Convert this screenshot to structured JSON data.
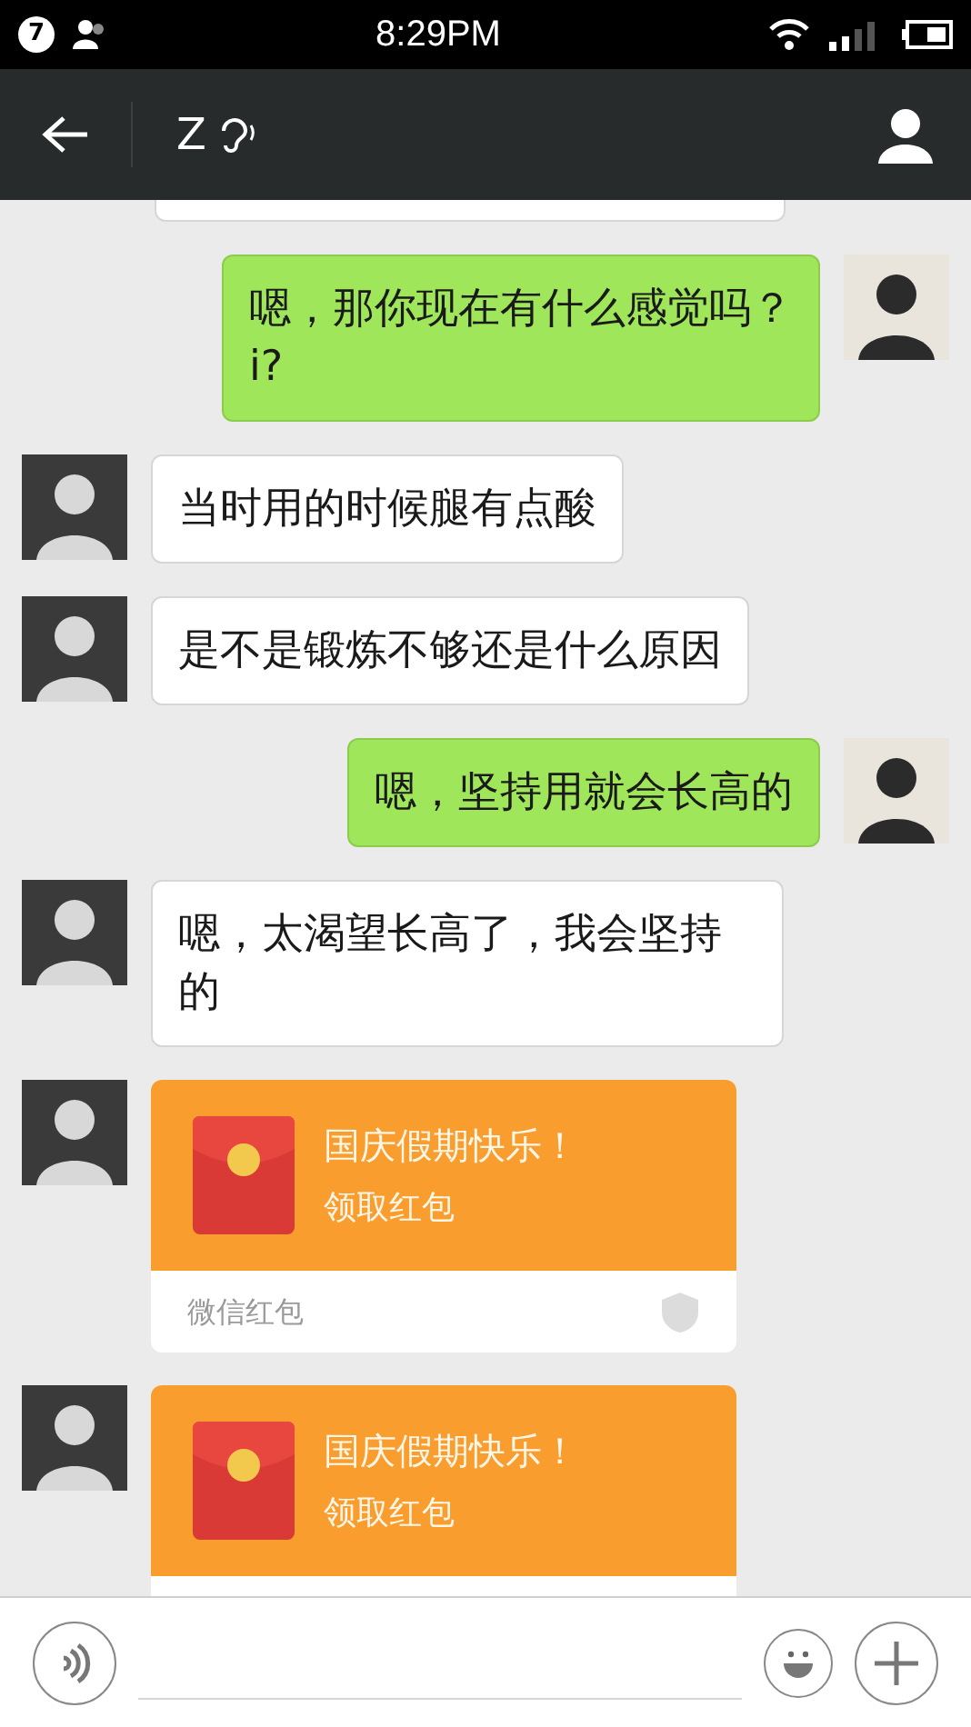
{
  "status_bar": {
    "notification_count": "7",
    "time": "8:29PM"
  },
  "header": {
    "title": "Z"
  },
  "messages": [
    {
      "kind": "text",
      "outgoing": true,
      "text": "嗯，那你现在有什么感觉吗？\ni?"
    },
    {
      "kind": "text",
      "outgoing": false,
      "text": "当时用的时候腿有点酸"
    },
    {
      "kind": "text",
      "outgoing": false,
      "text": "是不是锻炼不够还是什么原因"
    },
    {
      "kind": "text",
      "outgoing": true,
      "text": "嗯，坚持用就会长高的"
    },
    {
      "kind": "text",
      "outgoing": false,
      "text": "嗯，太渴望长高了，我会坚持的"
    },
    {
      "kind": "gift_packet",
      "outgoing": false,
      "greeting": "国庆假期快乐！",
      "action": "领取红包",
      "footer": "微信红包"
    },
    {
      "kind": "gift_packet",
      "outgoing": false,
      "greeting": "国庆假期快乐！",
      "action": "领取红包"
    }
  ]
}
